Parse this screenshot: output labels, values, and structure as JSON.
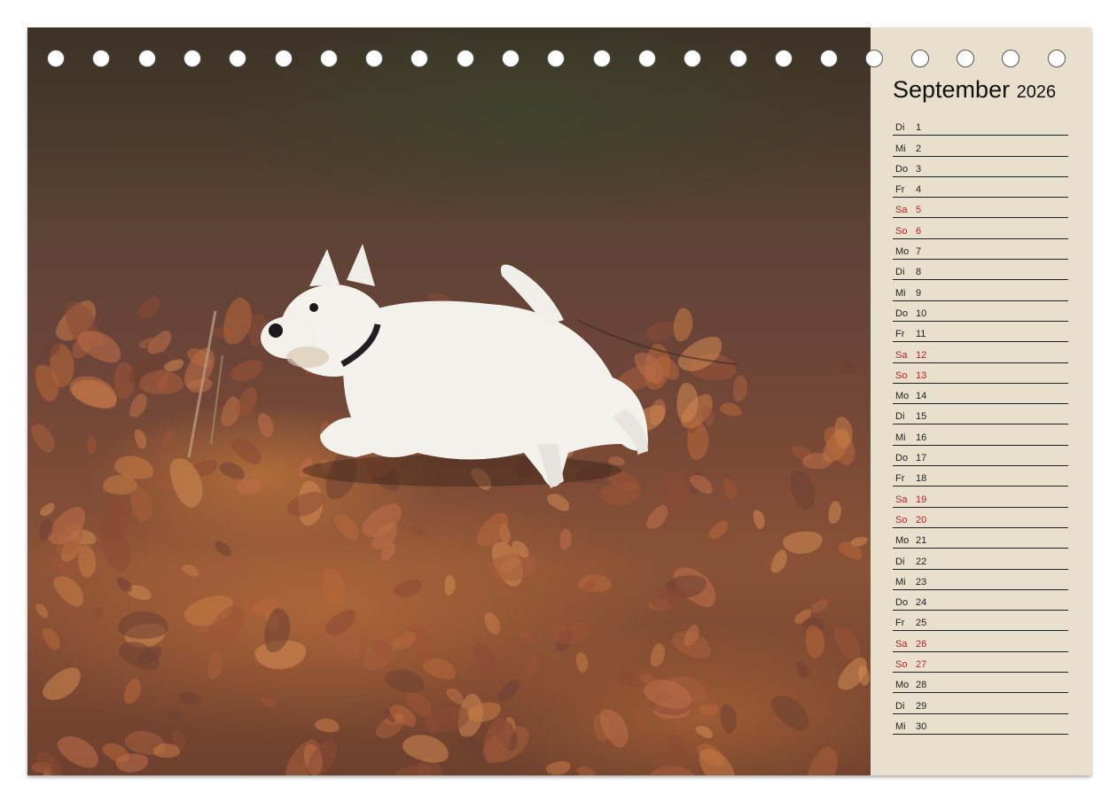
{
  "calendar": {
    "month": "September",
    "year": "2026",
    "weekend_color": "#b0262b",
    "photo_subject": "white-west-highland-terrier-in-autumn-leaves",
    "days": [
      {
        "name": "Di",
        "num": "1",
        "weekend": false
      },
      {
        "name": "Mi",
        "num": "2",
        "weekend": false
      },
      {
        "name": "Do",
        "num": "3",
        "weekend": false
      },
      {
        "name": "Fr",
        "num": "4",
        "weekend": false
      },
      {
        "name": "Sa",
        "num": "5",
        "weekend": true
      },
      {
        "name": "So",
        "num": "6",
        "weekend": true
      },
      {
        "name": "Mo",
        "num": "7",
        "weekend": false
      },
      {
        "name": "Di",
        "num": "8",
        "weekend": false
      },
      {
        "name": "Mi",
        "num": "9",
        "weekend": false
      },
      {
        "name": "Do",
        "num": "10",
        "weekend": false
      },
      {
        "name": "Fr",
        "num": "11",
        "weekend": false
      },
      {
        "name": "Sa",
        "num": "12",
        "weekend": true
      },
      {
        "name": "So",
        "num": "13",
        "weekend": true
      },
      {
        "name": "Mo",
        "num": "14",
        "weekend": false
      },
      {
        "name": "Di",
        "num": "15",
        "weekend": false
      },
      {
        "name": "Mi",
        "num": "16",
        "weekend": false
      },
      {
        "name": "Do",
        "num": "17",
        "weekend": false
      },
      {
        "name": "Fr",
        "num": "18",
        "weekend": false
      },
      {
        "name": "Sa",
        "num": "19",
        "weekend": true
      },
      {
        "name": "So",
        "num": "20",
        "weekend": true
      },
      {
        "name": "Mo",
        "num": "21",
        "weekend": false
      },
      {
        "name": "Di",
        "num": "22",
        "weekend": false
      },
      {
        "name": "Mi",
        "num": "23",
        "weekend": false
      },
      {
        "name": "Do",
        "num": "24",
        "weekend": false
      },
      {
        "name": "Fr",
        "num": "25",
        "weekend": false
      },
      {
        "name": "Sa",
        "num": "26",
        "weekend": true
      },
      {
        "name": "So",
        "num": "27",
        "weekend": true
      },
      {
        "name": "Mo",
        "num": "28",
        "weekend": false
      },
      {
        "name": "Di",
        "num": "29",
        "weekend": false
      },
      {
        "name": "Mi",
        "num": "30",
        "weekend": false
      }
    ]
  }
}
